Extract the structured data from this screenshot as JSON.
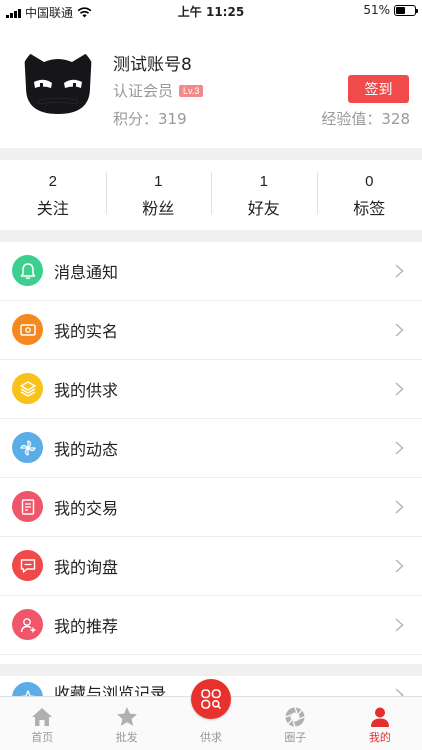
{
  "status_bar": {
    "carrier": "中国联通",
    "time": "上午 11:25",
    "battery_percent": "51%",
    "battery_level": 0.51
  },
  "profile": {
    "username": "测试账号8",
    "member_type": "认证会员",
    "level": "Lv.3",
    "points": "积分：319",
    "experience": "经验值：328",
    "checkin_label": "签到"
  },
  "stats": [
    {
      "count": "2",
      "label": "关注"
    },
    {
      "count": "1",
      "label": "粉丝"
    },
    {
      "count": "1",
      "label": "好友"
    },
    {
      "count": "0",
      "label": "标签"
    }
  ],
  "menu": [
    {
      "label": "消息通知",
      "icon": "bell-icon",
      "color": "#3ccf8e"
    },
    {
      "label": "我的实名",
      "icon": "id-card-icon",
      "color": "#f5891f"
    },
    {
      "label": "我的供求",
      "icon": "layers-icon",
      "color": "#f7c21a"
    },
    {
      "label": "我的动态",
      "icon": "pinwheel-icon",
      "color": "#5aaee8"
    },
    {
      "label": "我的交易",
      "icon": "document-icon",
      "color": "#f0566a"
    },
    {
      "label": "我的询盘",
      "icon": "chat-icon",
      "color": "#f04949"
    },
    {
      "label": "我的推荐",
      "icon": "user-add-icon",
      "color": "#f0566a"
    }
  ],
  "partial_menu_item": {
    "label": "收藏与浏览记录",
    "icon": "favorite-icon",
    "color": "#5aaee8"
  },
  "tab_bar": {
    "tabs": [
      {
        "label": "首页",
        "icon": "home-icon",
        "active": false
      },
      {
        "label": "批发",
        "icon": "star-icon",
        "active": false
      },
      {
        "label": "供求",
        "icon": "supply-demand-icon",
        "active": false
      },
      {
        "label": "圈子",
        "icon": "aperture-icon",
        "active": false
      },
      {
        "label": "我的",
        "icon": "profile-icon",
        "active": true
      }
    ],
    "active_color": "#e3302d",
    "inactive_color": "#999999"
  }
}
